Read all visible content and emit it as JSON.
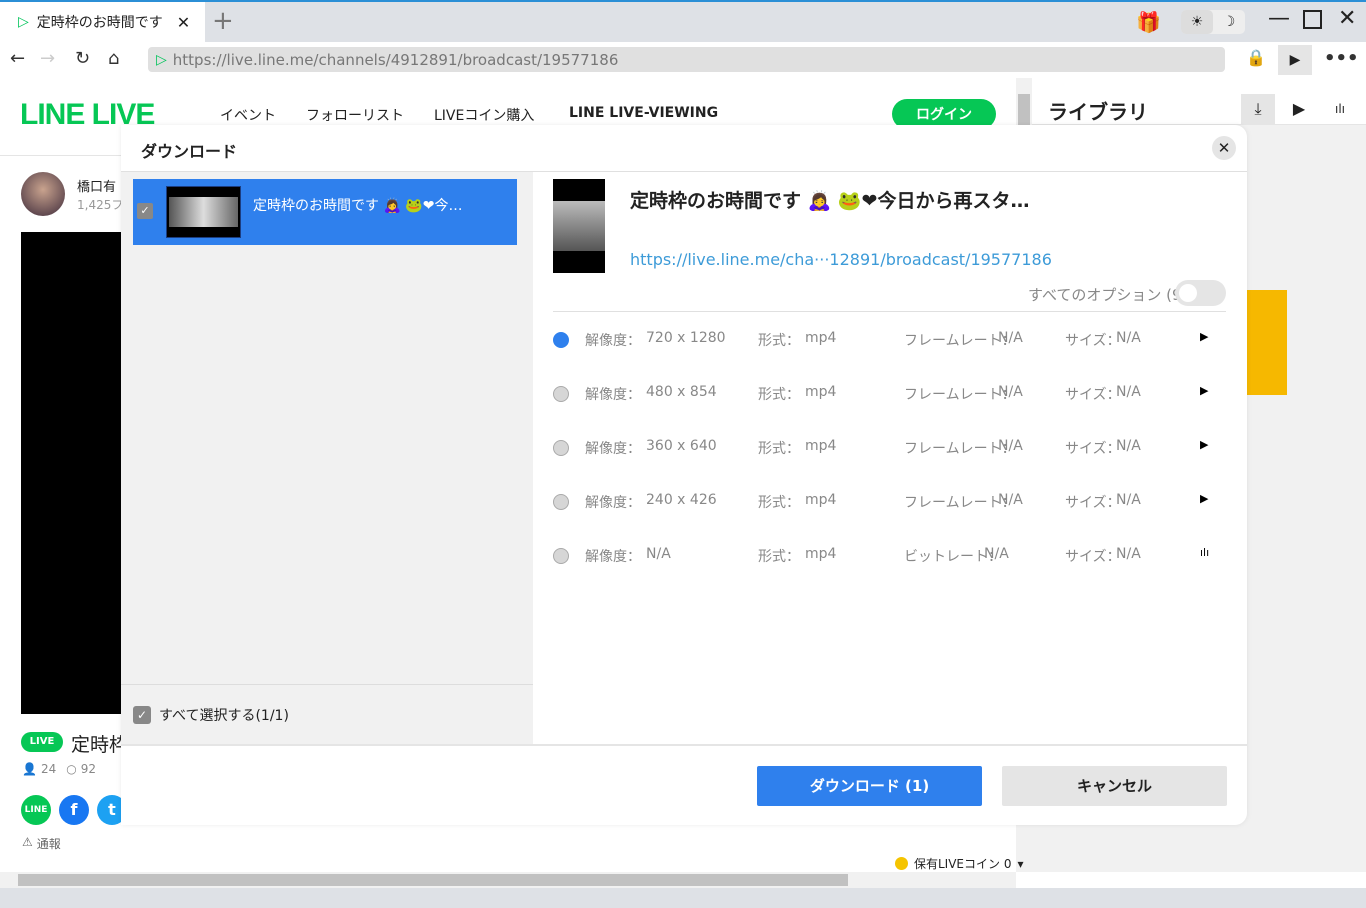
{
  "browser": {
    "tab_title": "定時枠のお時間です",
    "new_tab": "+",
    "url": "https://live.line.me/channels/4912891/broadcast/19577186",
    "icons": [
      "back-icon",
      "forward-icon",
      "reload-icon",
      "home-icon",
      "gift-icon",
      "sun-icon",
      "moon-icon",
      "lock-icon",
      "video-download-icon",
      "more-icon"
    ]
  },
  "site": {
    "logo": "LINE LIVE",
    "menu": [
      "イベント",
      "フォローリスト",
      "LIVEコイン購入",
      "LINE LIVE-VIEWING"
    ],
    "login": "ログイン",
    "channel_name": "橋口有",
    "followers": "1,425フ",
    "live_badge": "LIVE",
    "stream_title_partial": "定時枠",
    "viewers": "24",
    "comments": "92",
    "report": "通報",
    "coins": "保有LIVEコイン 0"
  },
  "library": {
    "title": "ライブラリ"
  },
  "dialog": {
    "title": "ダウンロード",
    "item_title": "定時枠のお時間です 🙇‍♀ 🐸❤今…",
    "select_all": "すべて選択する(1/1)",
    "detail_title": "定時枠のお時間です 🙇‍♀ 🐸❤今日から再スタ…",
    "detail_url": "https://live.line.me/cha···12891/broadcast/19577186",
    "all_options": "すべてのオプション (9)",
    "all_options_on": false,
    "options": [
      {
        "res_label": "解像度：",
        "res": "720 x 1280",
        "fmt_label": "形式：",
        "fmt": "mp4",
        "rate_label": "フレームレート：",
        "rate": "N/A",
        "size_label": "サイズ：",
        "size": "N/A",
        "selected": true,
        "icon": "video-icon"
      },
      {
        "res_label": "解像度：",
        "res": "480 x 854",
        "fmt_label": "形式：",
        "fmt": "mp4",
        "rate_label": "フレームレート：",
        "rate": "N/A",
        "size_label": "サイズ：",
        "size": "N/A",
        "selected": false,
        "icon": "video-icon"
      },
      {
        "res_label": "解像度：",
        "res": "360 x 640",
        "fmt_label": "形式：",
        "fmt": "mp4",
        "rate_label": "フレームレート：",
        "rate": "N/A",
        "size_label": "サイズ：",
        "size": "N/A",
        "selected": false,
        "icon": "video-icon"
      },
      {
        "res_label": "解像度：",
        "res": "240 x 426",
        "fmt_label": "形式：",
        "fmt": "mp4",
        "rate_label": "フレームレート：",
        "rate": "N/A",
        "size_label": "サイズ：",
        "size": "N/A",
        "selected": false,
        "icon": "video-icon"
      },
      {
        "res_label": "解像度：",
        "res": "N/A",
        "fmt_label": "形式：",
        "fmt": "mp4",
        "rate_label": "ビットレート：",
        "rate": "N/A",
        "size_label": "サイズ：",
        "size": "N/A",
        "selected": false,
        "icon": "audio-icon"
      }
    ],
    "download_button": "ダウンロード (1)",
    "cancel_button": "キャンセル"
  },
  "colors": {
    "accent": "#2f80ed",
    "brand": "#06c755"
  }
}
